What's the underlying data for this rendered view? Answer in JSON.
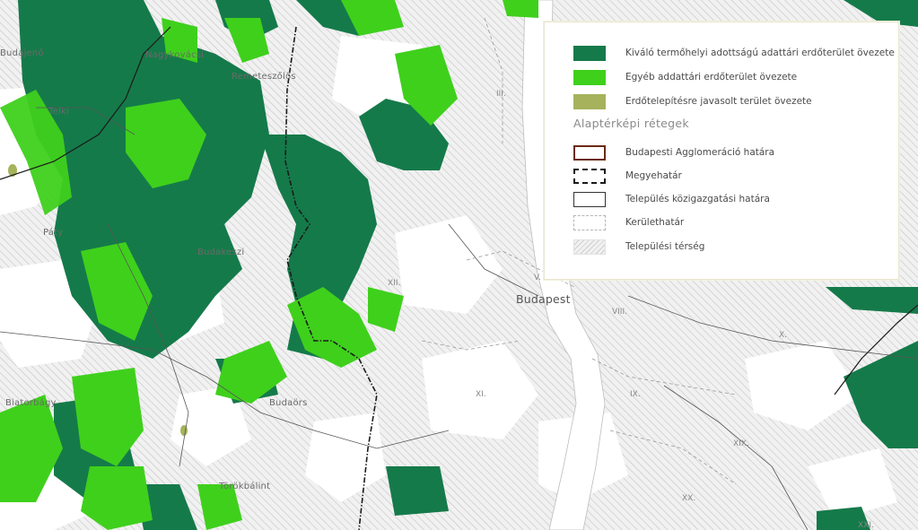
{
  "colors": {
    "forest_excellent": "#157a4a",
    "forest_other": "#3fd01c",
    "afforestation": "#a6b35c",
    "agglomeration_border": "#6b2a12",
    "settlement_hatch": "#c9c9c9"
  },
  "places": {
    "budajeno": "Budajenő",
    "nagykovacsi": "Nagykovácsi",
    "remeteszolos": "Remeteszőlős",
    "telki": "Telki",
    "paty": "Páty",
    "budakeszi": "Budakeszi",
    "biatorbagy": "Biatorbágy",
    "budaors": "Budaörs",
    "torokbalint": "Törökbálint",
    "budapest": "Budapest"
  },
  "districts": {
    "iii": "III.",
    "xii": "XII.",
    "v": "V.",
    "viii": "VIII.",
    "x": "X.",
    "xi": "XI.",
    "ix": "IX.",
    "xix": "XIX.",
    "xx": "XX.",
    "xxi": "XXI."
  },
  "legend": {
    "zones": [
      {
        "label": "Kiváló termőhelyi adottságú adattári erdőterület övezete",
        "icon": "dark-green-swatch"
      },
      {
        "label": "Egyéb addattári erdőterület övezete",
        "icon": "light-green-swatch"
      },
      {
        "label": "Erdőtelepítésre javasolt terület övezete",
        "icon": "olive-swatch"
      }
    ],
    "layers_title": "Alaptérképi rétegek",
    "layers": [
      {
        "label": "Budapesti Agglomeráció határa",
        "icon": "agglomeration-border-swatch"
      },
      {
        "label": "Megyehatár",
        "icon": "county-border-swatch"
      },
      {
        "label": "Település közigazgatási határa",
        "icon": "municipal-border-swatch"
      },
      {
        "label": "Kerülethatár",
        "icon": "district-border-swatch"
      },
      {
        "label": "Települési térség",
        "icon": "settlement-area-swatch"
      }
    ]
  }
}
